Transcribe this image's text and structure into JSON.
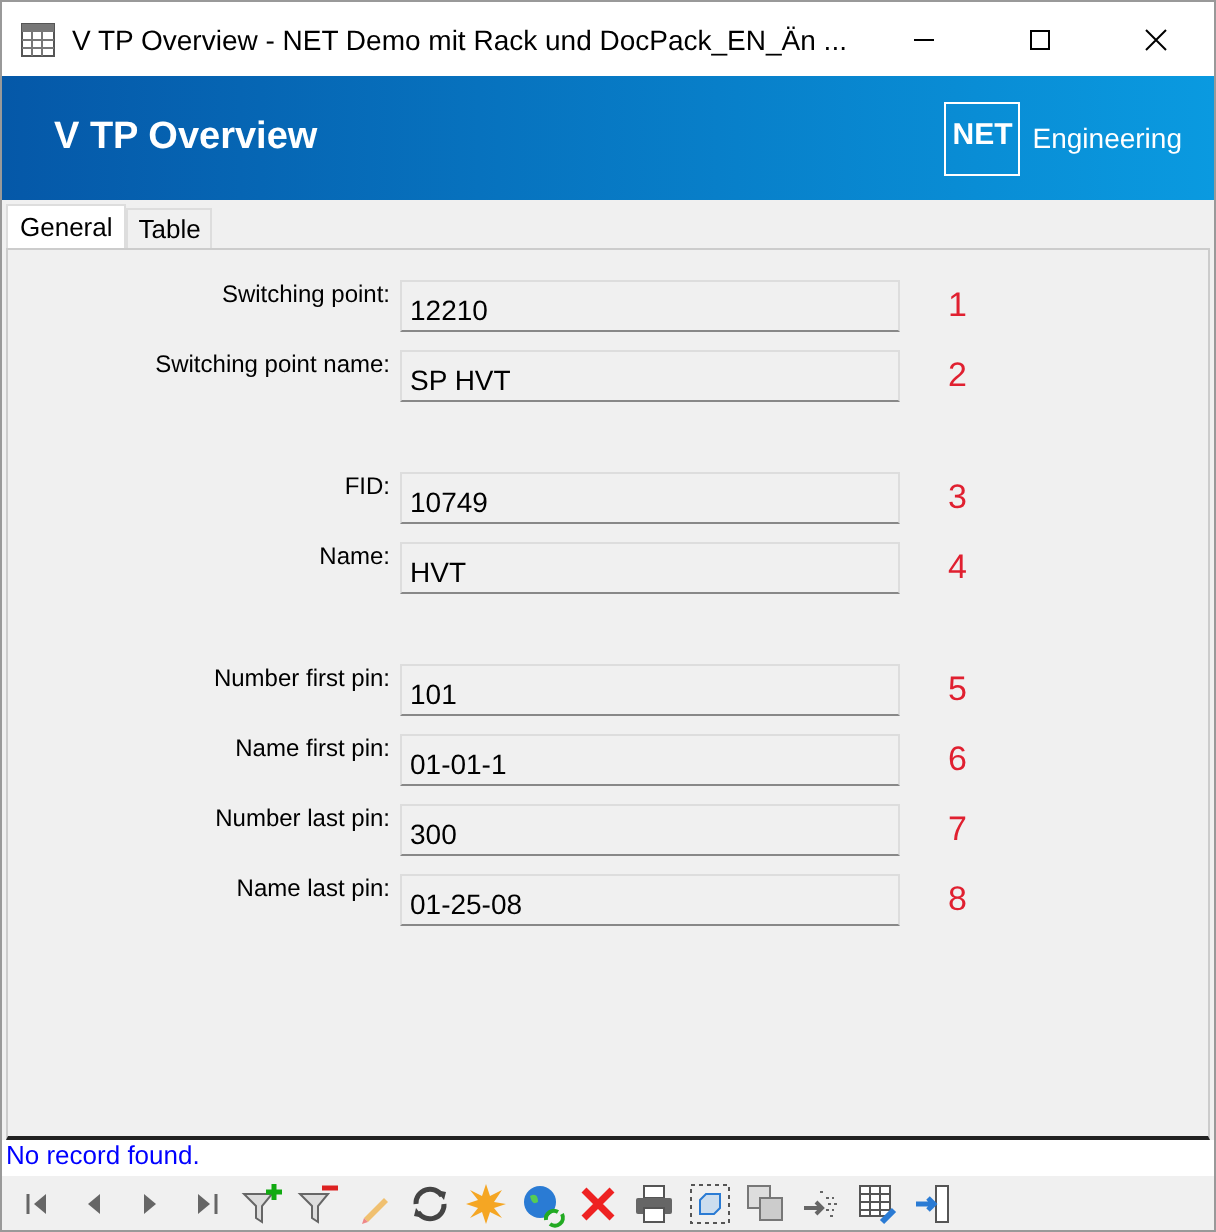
{
  "window": {
    "title": "V TP Overview - NET Demo mit Rack und DocPack_EN_Än ..."
  },
  "header": {
    "title": "V TP Overview",
    "logo_mark": "NET",
    "logo_text": "Engineering"
  },
  "tabs": [
    {
      "label": "General",
      "selected": true
    },
    {
      "label": "Table",
      "selected": false
    }
  ],
  "groups": [
    [
      {
        "label": "Switching point:",
        "value": "12210",
        "number": "1"
      },
      {
        "label": "Switching point name:",
        "value": "SP HVT",
        "number": "2"
      }
    ],
    [
      {
        "label": "FID:",
        "value": "10749",
        "number": "3"
      },
      {
        "label": "Name:",
        "value": "HVT",
        "number": "4"
      }
    ],
    [
      {
        "label": "Number first pin:",
        "value": "101",
        "number": "5"
      },
      {
        "label": "Name first pin:",
        "value": "01-01-1",
        "number": "6"
      },
      {
        "label": "Number last pin:",
        "value": "300",
        "number": "7"
      },
      {
        "label": "Name last pin:",
        "value": "01-25-08",
        "number": "8"
      }
    ]
  ],
  "status": "No record found."
}
